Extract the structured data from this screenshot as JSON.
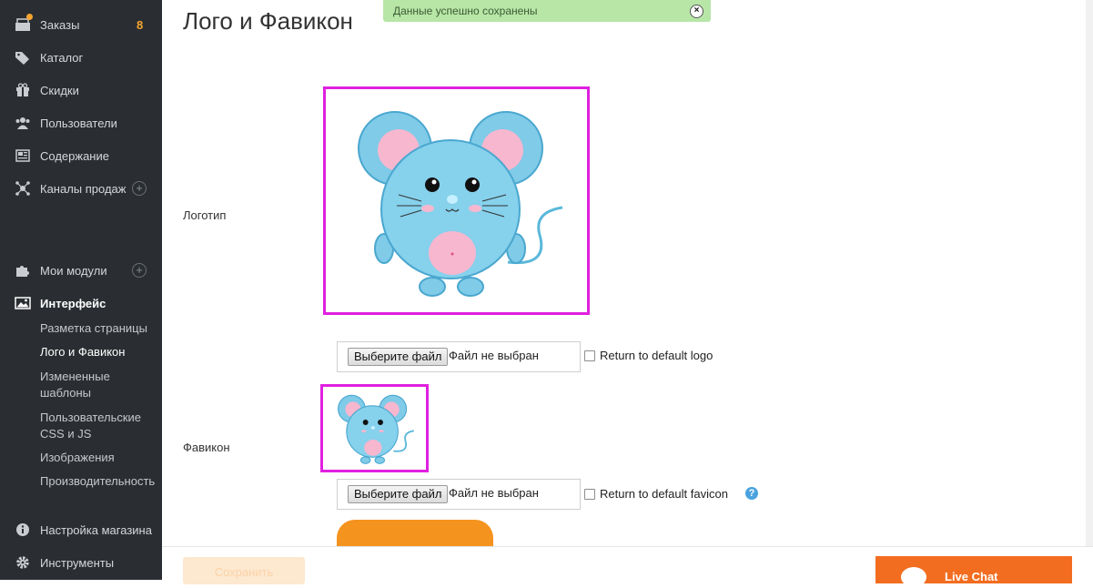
{
  "sidebar": {
    "items": [
      {
        "label": "Заказы",
        "badge": "8",
        "icon": "inbox-icon"
      },
      {
        "label": "Каталог",
        "icon": "tag-icon"
      },
      {
        "label": "Скидки",
        "icon": "gift-icon"
      },
      {
        "label": "Пользователи",
        "icon": "users-icon"
      },
      {
        "label": "Содержание",
        "icon": "newspaper-icon"
      },
      {
        "label": "Каналы продаж",
        "icon": "network-icon"
      },
      {
        "label": "Мои модули",
        "icon": "puzzle-icon"
      },
      {
        "label": "Интерфейс",
        "icon": "image-icon"
      },
      {
        "label": "Настройка магазина",
        "icon": "info-icon"
      },
      {
        "label": "Инструменты",
        "icon": "gear-icon"
      }
    ],
    "interface_sub": [
      "Разметка страницы",
      "Лого и Фавикон",
      "Измененные шаблоны",
      "Пользовательские CSS и JS",
      "Изображения",
      "Производительность"
    ],
    "plus": "+"
  },
  "page": {
    "title": "Лого и Фавикон"
  },
  "toast": {
    "message": "Данные успешно сохранены",
    "close": "×"
  },
  "logo": {
    "label": "Логотип",
    "choose_file": "Выберите файл",
    "no_file": "Файл не выбран",
    "reset": "Return to default logo"
  },
  "favicon": {
    "label": "Фавикон",
    "choose_file": "Выберите файл",
    "no_file": "Файл не выбран",
    "reset": "Return to default favicon",
    "help": "?"
  },
  "footer": {
    "save": "Сохранить",
    "live_chat": "Live Chat"
  },
  "colors": {
    "sidebar_bg": "#2a2e32",
    "accent": "#f5931f",
    "frame": "#e020e0",
    "toast_bg": "#b7e6a6"
  }
}
